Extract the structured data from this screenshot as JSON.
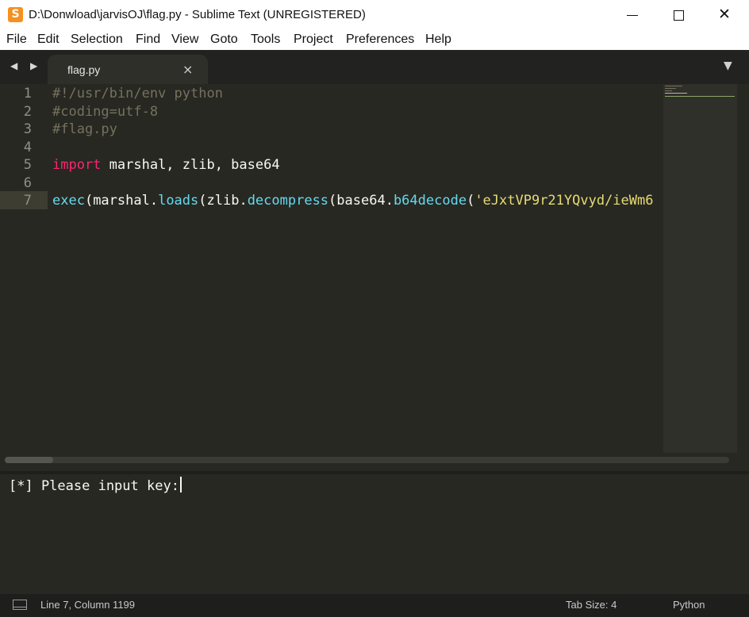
{
  "window": {
    "title": "D:\\Donwload\\jarvisOJ\\flag.py - Sublime Text (UNREGISTERED)",
    "app_icon_glyph": "S",
    "minimize_icon": "minimize-icon",
    "maximize_icon": "maximize-icon",
    "close_glyph": "✕"
  },
  "menu": {
    "items": [
      "File",
      "Edit",
      "Selection",
      "Find",
      "View",
      "Goto",
      "Tools",
      "Project",
      "Preferences",
      "Help"
    ]
  },
  "tabs": {
    "nav_arrows": "◀ ▶",
    "active": {
      "label": "flag.py",
      "close_glyph": "×"
    },
    "dropdown_glyph": "▼"
  },
  "editor": {
    "line_numbers": [
      "1",
      "2",
      "3",
      "4",
      "5",
      "6",
      "7"
    ],
    "current_line": "7",
    "lines": {
      "l1": "#!/usr/bin/env python",
      "l2": "#coding=utf-8",
      "l3": "#flag.py",
      "l5_kw": "import",
      "l5_rest": " marshal, zlib, base64",
      "l7": {
        "t1": "exec",
        "t2": "(marshal.",
        "t3": "loads",
        "t4": "(zlib.",
        "t5": "decompress",
        "t6": "(base64.",
        "t7": "b64decode",
        "t8": "(",
        "t9": "'eJxtVP9r21YQvyd/ieWm6"
      }
    },
    "colors": {
      "background": "#272822",
      "comment": "#75715e",
      "keyword": "#f92672",
      "function": "#66d9ef",
      "string": "#e6db74"
    }
  },
  "output_panel": {
    "text": "[*] Please input key:"
  },
  "status_bar": {
    "position": "Line 7, Column 1199",
    "tab_size": "Tab Size: 4",
    "syntax": "Python"
  }
}
